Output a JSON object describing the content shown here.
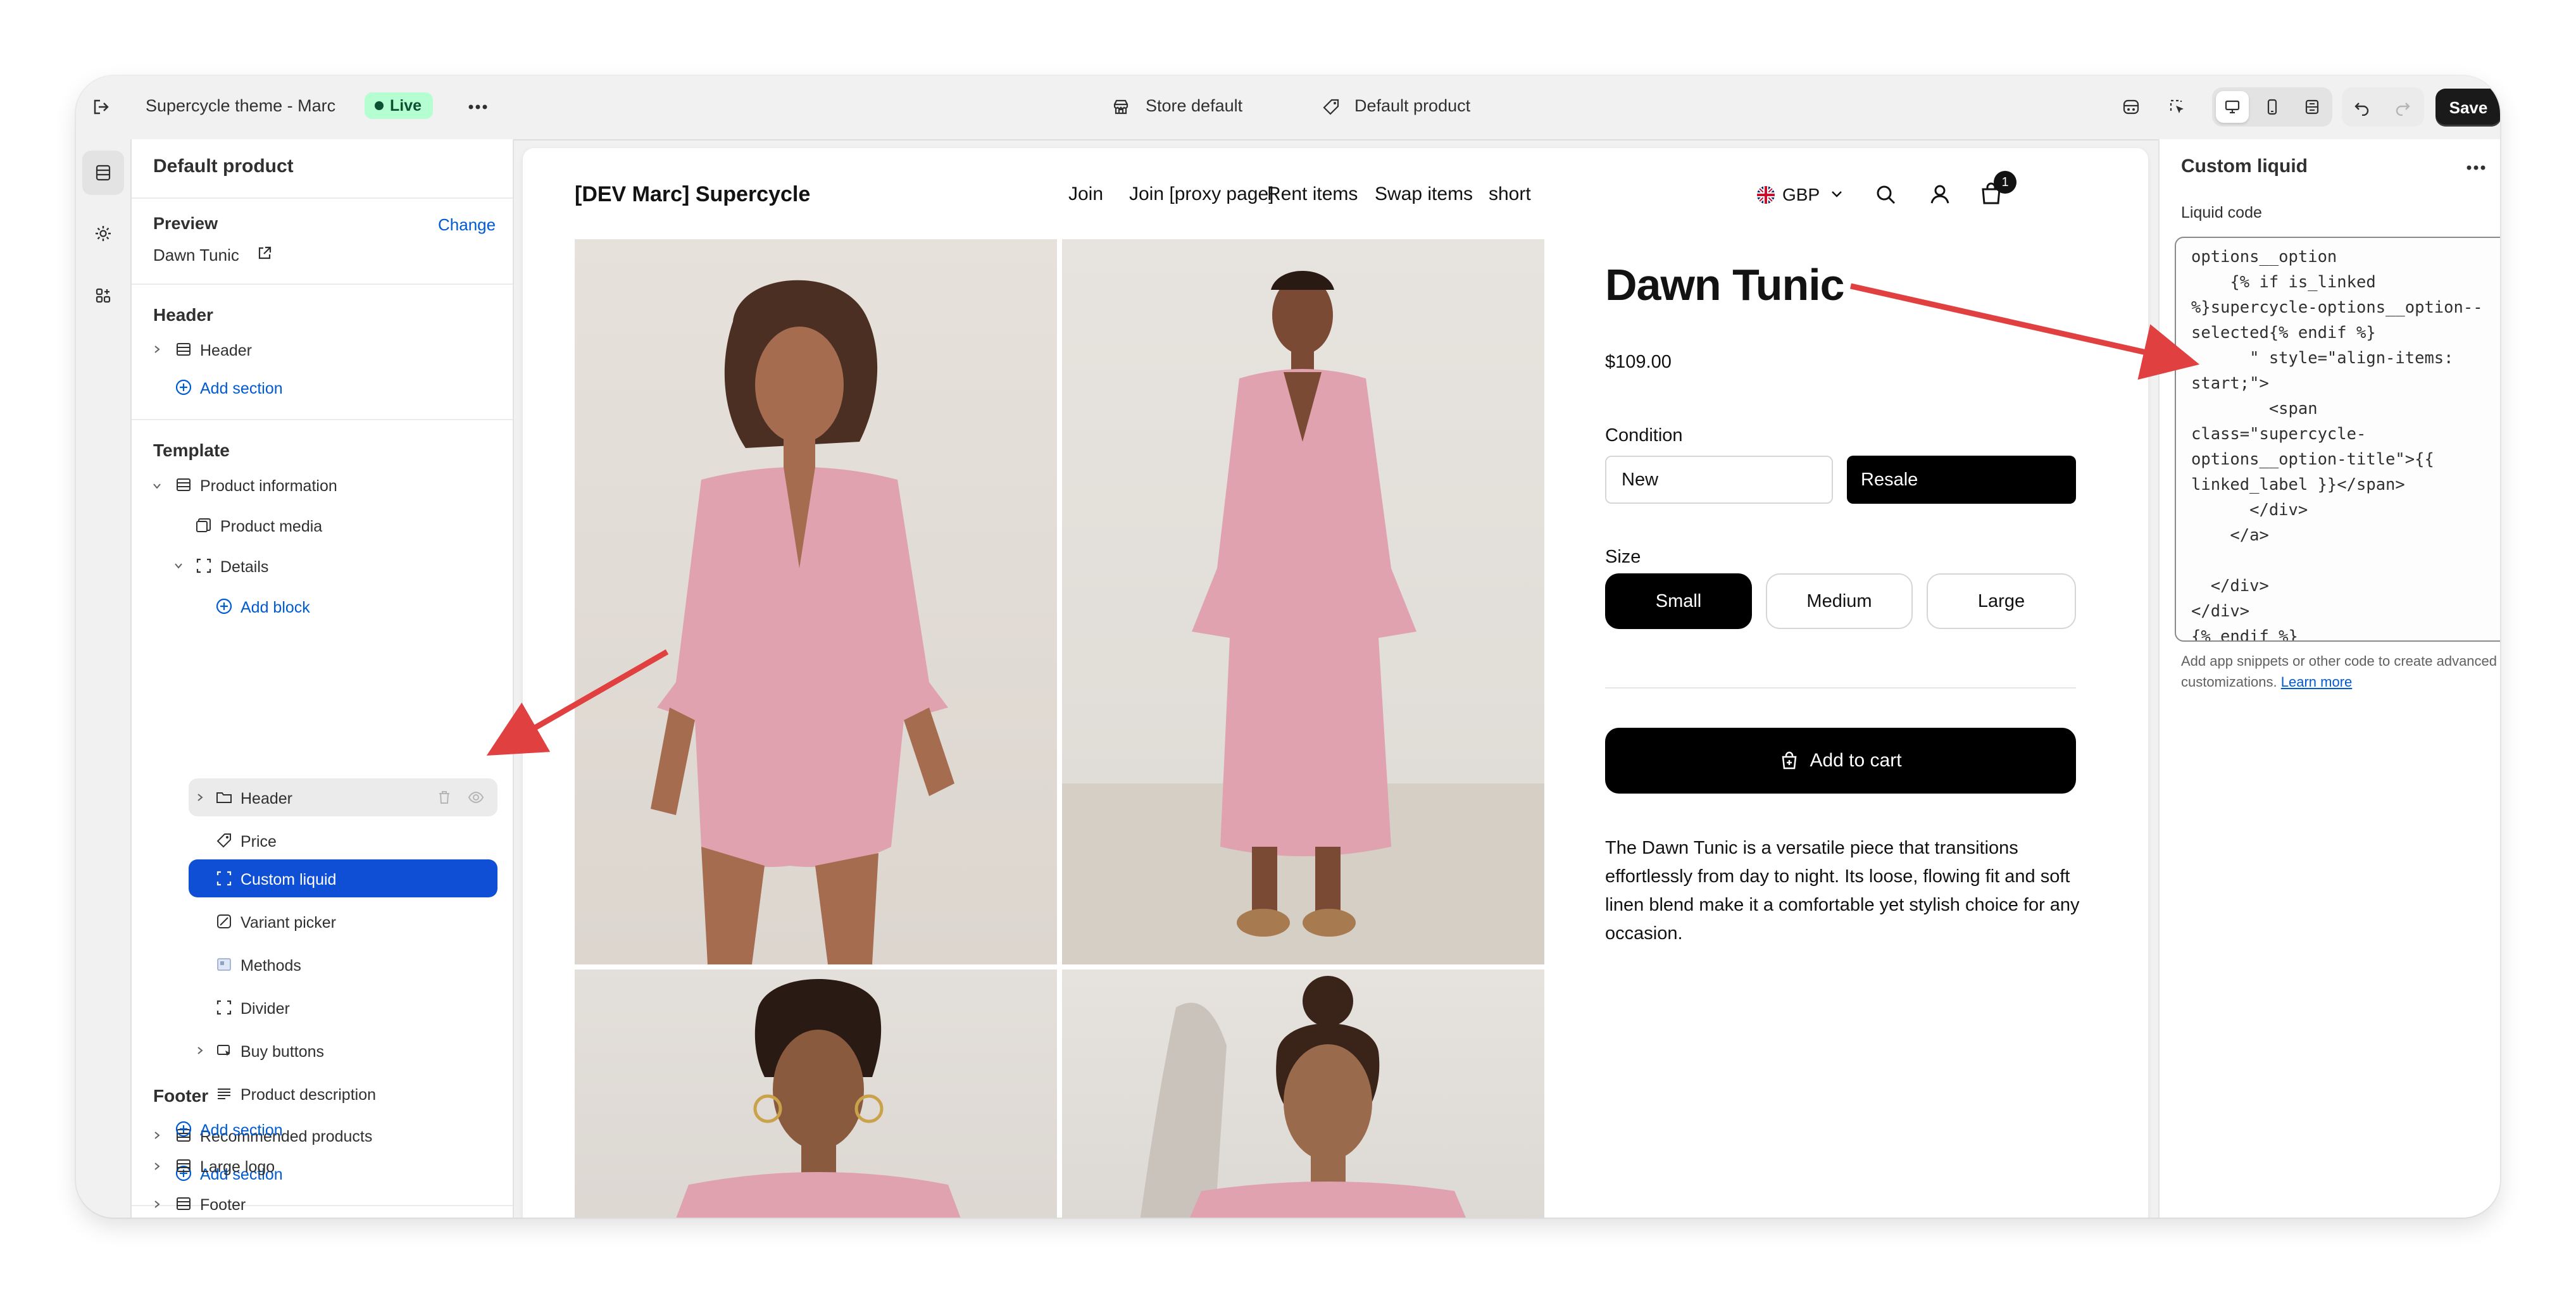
{
  "topbar": {
    "theme_name": "Supercycle theme - Marc",
    "live_label": "Live",
    "store_selector": "Store default",
    "template_selector": "Default product",
    "save_label": "Save"
  },
  "left_panel": {
    "title": "Default product",
    "preview_label": "Preview",
    "change_label": "Change",
    "preview_product": "Dawn Tunic",
    "header_group": "Header",
    "header_item": "Header",
    "add_section": "Add section",
    "template_group": "Template",
    "product_information": "Product information",
    "blocks": {
      "product_media": "Product media",
      "details": "Details",
      "add_block": "Add block",
      "header": "Header",
      "price": "Price",
      "custom_liquid": "Custom liquid",
      "variant_picker": "Variant picker",
      "methods": "Methods",
      "divider": "Divider",
      "buy_buttons": "Buy buttons",
      "product_description": "Product description"
    },
    "recommended_products": "Recommended products",
    "footer_group": "Footer",
    "large_logo": "Large logo",
    "footer_item": "Footer"
  },
  "store": {
    "name": "[DEV Marc] Supercycle",
    "nav": [
      "Join",
      "Join [proxy page]",
      "Rent items",
      "Swap items",
      "short"
    ],
    "currency": "GBP",
    "cart_count": "1"
  },
  "product": {
    "title": "Dawn Tunic",
    "price": "$109.00",
    "condition_label": "Condition",
    "condition_options": [
      "New",
      "Resale"
    ],
    "condition_selected": "Resale",
    "size_label": "Size",
    "size_options": [
      "Small",
      "Medium",
      "Large"
    ],
    "size_selected": "Small",
    "add_to_cart": "Add to cart",
    "description": "The Dawn Tunic is a versatile piece that transitions effortlessly from day to night. Its loose, flowing fit and soft linen blend make it a comfortable yet stylish choice for any occasion."
  },
  "right_panel": {
    "title": "Custom liquid",
    "field_label": "Liquid code",
    "code": "options__option\n    {% if is_linked\n%}supercycle-options__option--\nselected{% endif %}\n      \" style=\"align-items:\nstart;\">\n        <span\nclass=\"supercycle-\noptions__option-title\">{{\nlinked_label }}</span>\n      </div>\n    </a>\n\n  </div>\n</div>\n{% endif %}",
    "help_text": "Add app snippets or other code to create advanced customizations.",
    "learn_more": "Learn more"
  },
  "colors": {
    "accent_blue": "#005bd3",
    "selected_row": "#0f4fd6",
    "live_badge": "#b4fed2",
    "annotation_arrow": "#e04040",
    "product_pink": "#dfa2ae"
  }
}
